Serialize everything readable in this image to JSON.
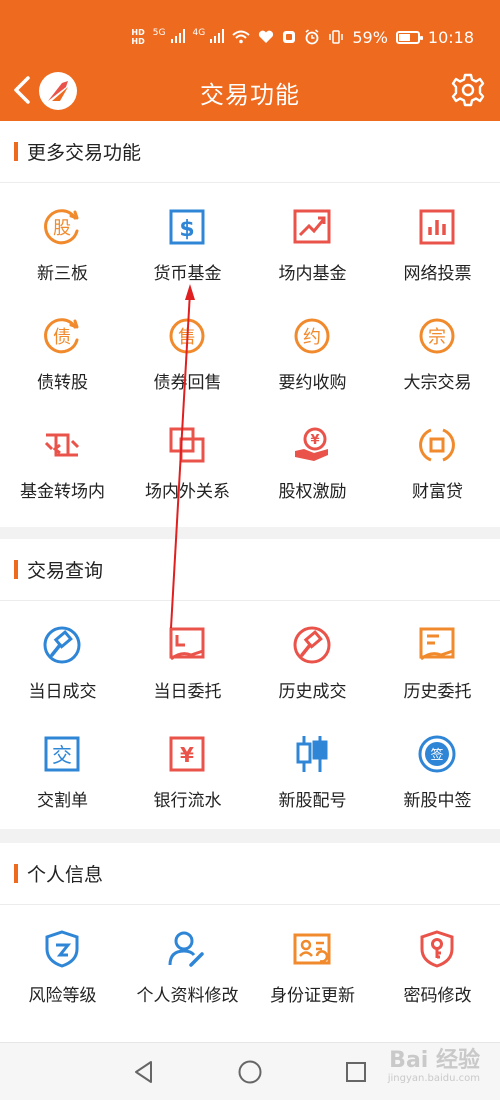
{
  "status": {
    "hd1": "HD",
    "hd2": "HD",
    "net1": "5G",
    "net2": "4G",
    "battery": "59%",
    "time": "10:18"
  },
  "header": {
    "title": "交易功能"
  },
  "sections": [
    {
      "title": "更多交易功能",
      "items": [
        {
          "label": "新三板",
          "icon": "gu-coin-icon",
          "glyph": "股"
        },
        {
          "label": "货币基金",
          "icon": "dollar-box-icon"
        },
        {
          "label": "场内基金",
          "icon": "trend-chart-icon"
        },
        {
          "label": "网络投票",
          "icon": "bar-chart-icon"
        },
        {
          "label": "债转股",
          "icon": "zhai-coin-icon",
          "glyph": "债"
        },
        {
          "label": "债券回售",
          "icon": "shou-coin-icon",
          "glyph": "售"
        },
        {
          "label": "要约收购",
          "icon": "yue-coin-icon",
          "glyph": "约"
        },
        {
          "label": "大宗交易",
          "icon": "zong-coin-icon",
          "glyph": "宗"
        },
        {
          "label": "基金转场内",
          "icon": "transfer-icon"
        },
        {
          "label": "场内外关系",
          "icon": "overlap-squares-icon"
        },
        {
          "label": "股权激励",
          "icon": "yen-hand-icon",
          "glyph": "¥"
        },
        {
          "label": "财富贷",
          "icon": "loan-coin-icon"
        }
      ]
    },
    {
      "title": "交易查询",
      "items": [
        {
          "label": "当日成交",
          "icon": "hammer-coin-icon"
        },
        {
          "label": "当日委托",
          "icon": "entrust-chart-icon"
        },
        {
          "label": "历史成交",
          "icon": "hammer-coin-icon"
        },
        {
          "label": "历史委托",
          "icon": "entrust-doc-icon"
        },
        {
          "label": "交割单",
          "icon": "jiao-box-icon",
          "glyph": "交"
        },
        {
          "label": "银行流水",
          "icon": "yen-box-icon",
          "glyph": "¥"
        },
        {
          "label": "新股配号",
          "icon": "candlestick-icon"
        },
        {
          "label": "新股中签",
          "icon": "qian-badge-icon",
          "glyph": "签"
        }
      ]
    },
    {
      "title": "个人信息",
      "items": [
        {
          "label": "风险等级",
          "icon": "shield-icon"
        },
        {
          "label": "个人资料修改",
          "icon": "user-edit-icon"
        },
        {
          "label": "身份证更新",
          "icon": "id-card-icon"
        },
        {
          "label": "密码修改",
          "icon": "key-shield-icon"
        }
      ]
    }
  ],
  "watermark": {
    "main": "Bai 经验",
    "sub": "jingyan.baidu.com"
  },
  "colors": {
    "brand": "#ee6a1e",
    "orange": "#f08a2c",
    "blue": "#2f86d6",
    "red": "#e9534a"
  }
}
